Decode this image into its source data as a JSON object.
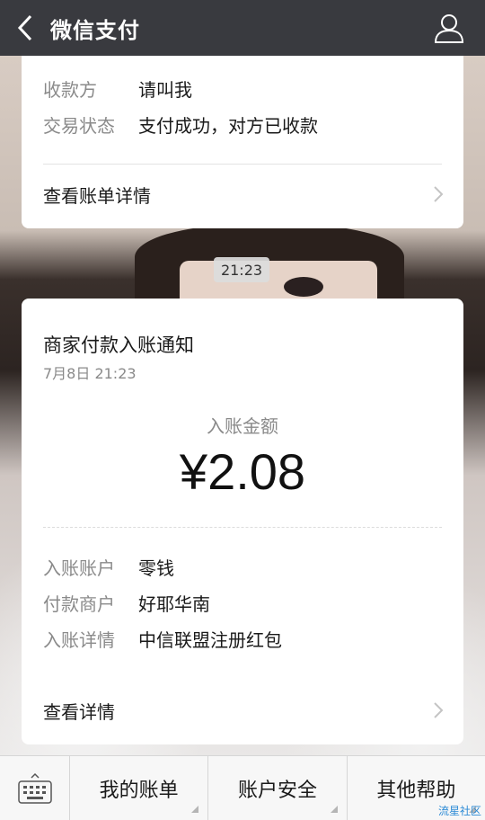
{
  "header": {
    "title": "微信支付"
  },
  "card1": {
    "rows": [
      {
        "key": "收款方",
        "value": "请叫我"
      },
      {
        "key": "交易状态",
        "value": "支付成功，对方已收款"
      }
    ],
    "link": "查看账单详情"
  },
  "time_badge": "21:23",
  "card2": {
    "title": "商家付款入账通知",
    "date": "7月8日  21:23",
    "amount_label": "入账金额",
    "amount": "¥2.08",
    "rows": [
      {
        "key": "入账账户",
        "value": "零钱"
      },
      {
        "key": "付款商户",
        "value": "好耶华南"
      },
      {
        "key": "入账详情",
        "value": "中信联盟注册红包"
      }
    ],
    "link": "查看详情"
  },
  "bottom_menu": {
    "items": [
      "我的账单",
      "账户安全",
      "其他帮助"
    ]
  },
  "watermark": "流星社区",
  "colors": {
    "topbar": "#393a3f",
    "muted": "#8a8a8a"
  },
  "icons": [
    "back-icon",
    "user-icon",
    "chevron-right-icon",
    "keyboard-icon"
  ]
}
